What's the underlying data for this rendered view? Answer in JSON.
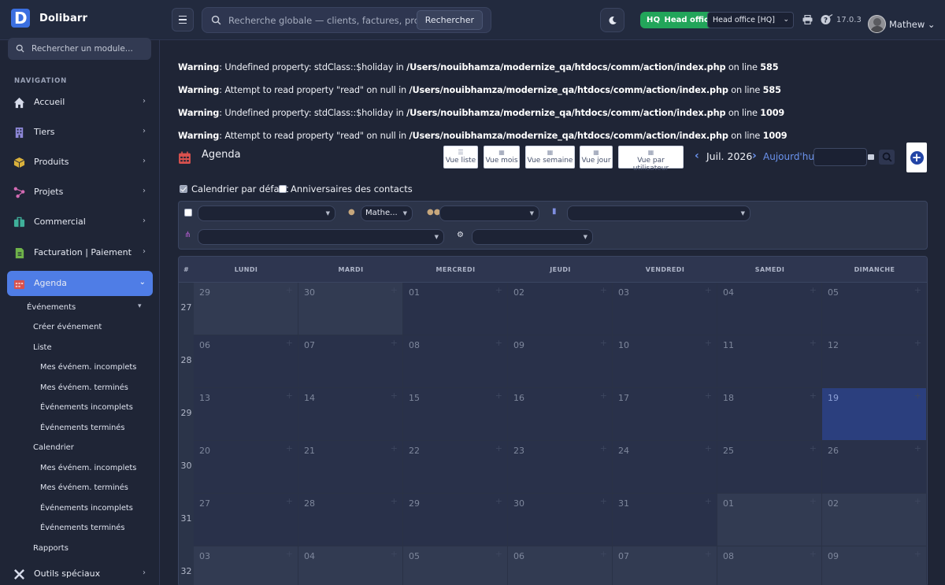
{
  "app": {
    "name": "Dolibarr",
    "version": "17.0.3",
    "user": "Mathew"
  },
  "topbar": {
    "search_placeholder": "Recherche globale — clients, factures, produits...",
    "search_button": "Rechercher",
    "hq_tag": "HQ",
    "hq_label": "Head office",
    "entity_selected": "Head office [HQ]"
  },
  "sidebar": {
    "search_placeholder": "Rechercher un module...",
    "section_title": "NAVIGATION",
    "items": [
      {
        "label": "Accueil",
        "icon": "home-icon"
      },
      {
        "label": "Tiers",
        "icon": "building-icon"
      },
      {
        "label": "Produits",
        "icon": "box-icon"
      },
      {
        "label": "Projets",
        "icon": "project-icon"
      },
      {
        "label": "Commercial",
        "icon": "briefcase-icon"
      },
      {
        "label": "Facturation | Paiement",
        "icon": "invoice-icon"
      },
      {
        "label": "Agenda",
        "icon": "calendar-icon"
      },
      {
        "label": "Outils spéciaux",
        "icon": "tools-icon"
      }
    ],
    "agenda_sub": {
      "evenements": "Événements",
      "creer": "Créer événement",
      "liste": "Liste",
      "liste_items": [
        "Mes événem. incomplets",
        "Mes événem. terminés",
        "Événements incomplets",
        "Événements terminés"
      ],
      "calendrier": "Calendrier",
      "calendrier_items": [
        "Mes événem. incomplets",
        "Mes événem. terminés",
        "Événements incomplets",
        "Événements terminés"
      ],
      "rapports": "Rapports"
    }
  },
  "warnings": [
    {
      "label": "Warning",
      "msg": ": Undefined property: stdClass::$holiday in ",
      "path": "/Users/nouibhamza/modernize_qa/htdocs/comm/action/index.php",
      "on": " on line ",
      "line": "585"
    },
    {
      "label": "Warning",
      "msg": ": Attempt to read property \"read\" on null in ",
      "path": "/Users/nouibhamza/modernize_qa/htdocs/comm/action/index.php",
      "on": " on line ",
      "line": "585"
    },
    {
      "label": "Warning",
      "msg": ": Undefined property: stdClass::$holiday in ",
      "path": "/Users/nouibhamza/modernize_qa/htdocs/comm/action/index.php",
      "on": " on line ",
      "line": "1009"
    },
    {
      "label": "Warning",
      "msg": ": Attempt to read property \"read\" on null in ",
      "path": "/Users/nouibhamza/modernize_qa/htdocs/comm/action/index.php",
      "on": " on line ",
      "line": "1009"
    }
  ],
  "agenda": {
    "title": "Agenda",
    "views": [
      "Vue liste",
      "Vue mois",
      "Vue semaine",
      "Vue jour",
      "Vue par utilisateur"
    ],
    "month": "Juil. 2026",
    "today": "Aujourd'hui",
    "chk_default_calendar": "Calendrier par défaut",
    "chk_birthdays": "Anniversaires des contacts",
    "filter_user": "Mathe...",
    "col_hash": "#",
    "days": [
      "LUNDI",
      "MARDI",
      "MERCREDI",
      "JEUDI",
      "VENDREDI",
      "SAMEDI",
      "DIMANCHE"
    ],
    "weeks": [
      {
        "num": "27",
        "days": [
          "29",
          "30",
          "01",
          "02",
          "03",
          "04",
          "05"
        ]
      },
      {
        "num": "28",
        "days": [
          "06",
          "07",
          "08",
          "09",
          "10",
          "11",
          "12"
        ]
      },
      {
        "num": "29",
        "days": [
          "13",
          "14",
          "15",
          "16",
          "17",
          "18",
          "19"
        ]
      },
      {
        "num": "30",
        "days": [
          "20",
          "21",
          "22",
          "23",
          "24",
          "25",
          "26"
        ]
      },
      {
        "num": "31",
        "days": [
          "27",
          "28",
          "29",
          "30",
          "31",
          "01",
          "02"
        ]
      },
      {
        "num": "32",
        "days": [
          "03",
          "04",
          "05",
          "06",
          "07",
          "08",
          "09"
        ]
      }
    ]
  }
}
